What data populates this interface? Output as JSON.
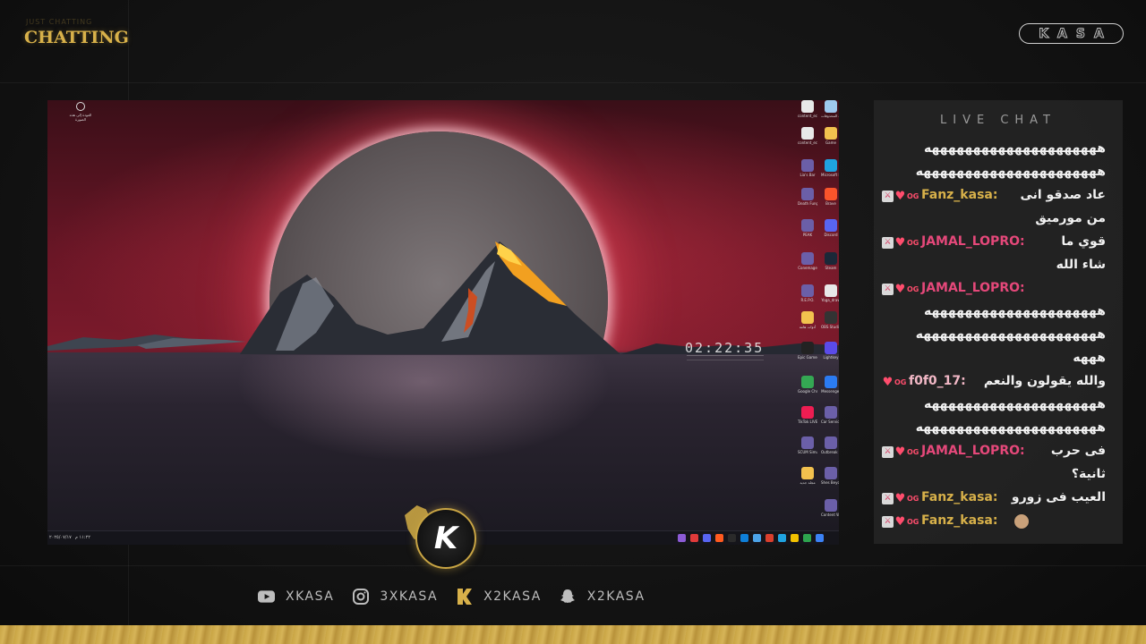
{
  "overlay": {
    "brand_title": "CHATTING",
    "brand_subtitle": "JUST CHATTING",
    "logo_text": "KASA",
    "accent_color": "#d8b14a"
  },
  "screen": {
    "clock": "02:22:35",
    "top_left_icon_label": "العودة إلى هذه الصورة",
    "taskbar_time": "١١:٢٢ م",
    "taskbar_date": "٢٠٢٥/٠٧/١٧",
    "desktop_icons": [
      {
        "label": "content_eco...",
        "icon": "file-icon"
      },
      {
        "label": "سلة المحذوفات",
        "icon": "recycle-bin-icon"
      },
      {
        "label": "content_eco...",
        "icon": "file-icon"
      },
      {
        "label": "Game",
        "icon": "folder-icon"
      },
      {
        "label": "Lia's Bar",
        "icon": "game-icon"
      },
      {
        "label": "Microsoft Edge",
        "icon": "edge-icon"
      },
      {
        "label": "Death Fungeon",
        "icon": "game-icon"
      },
      {
        "label": "Brave",
        "icon": "brave-icon"
      },
      {
        "label": "PEAK",
        "icon": "game-icon"
      },
      {
        "label": "Discord",
        "icon": "discord-icon"
      },
      {
        "label": "Conemage",
        "icon": "game-icon"
      },
      {
        "label": "Steam",
        "icon": "steam-icon"
      },
      {
        "label": "R.E.P.O.",
        "icon": "game-icon"
      },
      {
        "label": "Yoga_draw",
        "icon": "file-icon"
      },
      {
        "label": "أدوات هامة",
        "icon": "folder-icon"
      },
      {
        "label": "OBS Studio",
        "icon": "obs-icon"
      },
      {
        "label": "Epic Games Launcher",
        "icon": "epic-icon"
      },
      {
        "label": "Lightkey",
        "icon": "app-icon"
      },
      {
        "label": "Google Chrome",
        "icon": "chrome-icon"
      },
      {
        "label": "Messenger",
        "icon": "messenger-icon"
      },
      {
        "label": "TikTok LIVE Studio",
        "icon": "tiktok-icon"
      },
      {
        "label": "Car Service Together",
        "icon": "game-icon"
      },
      {
        "label": "SCUM Simulator",
        "icon": "game-icon"
      },
      {
        "label": "Outbreak Demo",
        "icon": "game-icon"
      },
      {
        "label": "مجلد جديد",
        "icon": "folder-icon"
      },
      {
        "label": "Shes Beyond",
        "icon": "game-icon"
      },
      {
        "label": "Content Warning",
        "icon": "game-icon"
      }
    ]
  },
  "chat": {
    "title": "LIVE CHAT",
    "lines": [
      {
        "kind": "text",
        "text": "هههههههههههههههههههههه"
      },
      {
        "kind": "text",
        "text": "ههههههههههههههههههههههه"
      },
      {
        "kind": "user",
        "user": "Fanz_kasa:",
        "color": "gold",
        "text": "عاد صدقو انى"
      },
      {
        "kind": "text",
        "text": "من مورميق"
      },
      {
        "kind": "user",
        "user": "JAMAL_LOPRO:",
        "color": "pink",
        "text": "قوي ما"
      },
      {
        "kind": "text",
        "text": "شاء الله"
      },
      {
        "kind": "user",
        "user": "JAMAL_LOPRO:",
        "color": "pink",
        "text": ""
      },
      {
        "kind": "text",
        "text": "هههههههههههههههههههههه"
      },
      {
        "kind": "text",
        "text": "ههههههههههههههههههههههه"
      },
      {
        "kind": "text",
        "text": "هههه"
      },
      {
        "kind": "user",
        "user": "f0f0_17:",
        "color": "rose",
        "text": "والله يقولون والنعم"
      },
      {
        "kind": "text",
        "text": "هههههههههههههههههههههه"
      },
      {
        "kind": "text",
        "text": "ههههههههههههههههههههههه"
      },
      {
        "kind": "user",
        "user": "JAMAL_LOPRO:",
        "color": "pink",
        "text": "فى حرب"
      },
      {
        "kind": "text",
        "text": "ثانية؟"
      },
      {
        "kind": "user",
        "user": "Fanz_kasa:",
        "color": "gold",
        "text": "العيب فى زورو"
      },
      {
        "kind": "user",
        "user": "Fanz_kasa:",
        "color": "gold",
        "text": ""
      }
    ]
  },
  "socials": [
    {
      "icon": "youtube-icon",
      "handle": "XKASA"
    },
    {
      "icon": "instagram-icon",
      "handle": "3XKASA"
    },
    {
      "icon": "kick-icon",
      "handle": "X2KASA"
    },
    {
      "icon": "snapchat-icon",
      "handle": "X2KASA"
    }
  ]
}
